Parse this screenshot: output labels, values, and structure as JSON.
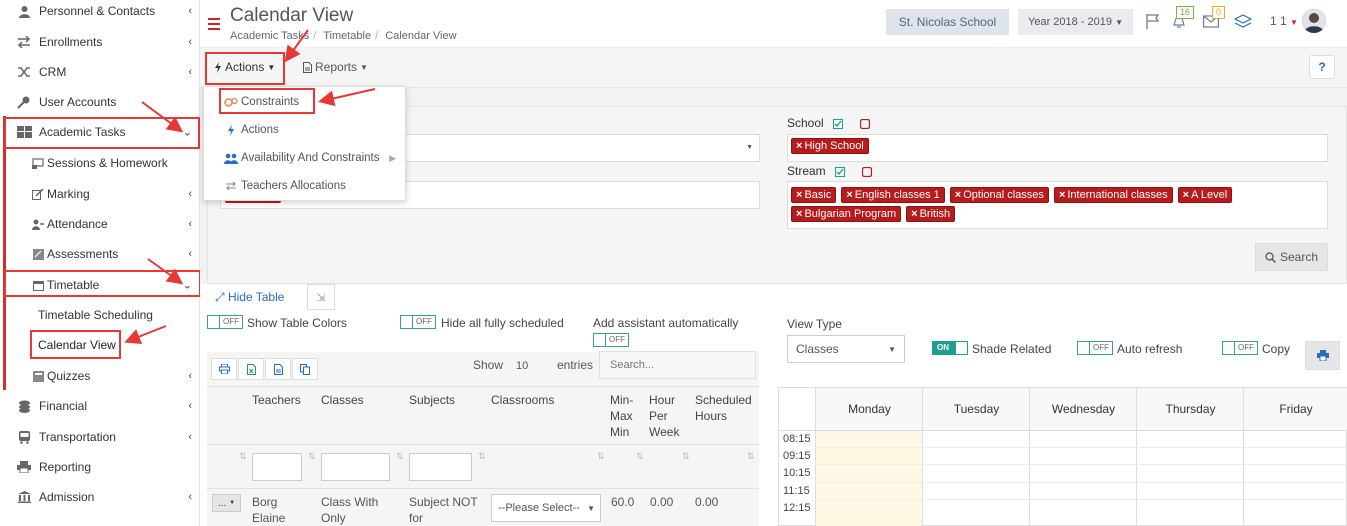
{
  "sidebar": {
    "items": [
      {
        "label": "Personnel & Contacts",
        "icon": "person-icon"
      },
      {
        "label": "Enrollments",
        "icon": "exchange-icon"
      },
      {
        "label": "CRM",
        "icon": "shuffle-icon"
      },
      {
        "label": "User Accounts",
        "icon": "key-icon"
      },
      {
        "label": "Academic Tasks",
        "icon": "grid-icon"
      },
      {
        "label": "Financial",
        "icon": "coins-icon"
      },
      {
        "label": "Transportation",
        "icon": "bus-icon"
      },
      {
        "label": "Reporting",
        "icon": "printer-icon"
      },
      {
        "label": "Admission",
        "icon": "bank-icon"
      }
    ],
    "academic_sub": [
      {
        "label": "Sessions & Homework"
      },
      {
        "label": "Marking"
      },
      {
        "label": "Attendance"
      },
      {
        "label": "Assessments"
      },
      {
        "label": "Timetable"
      },
      {
        "label": "Timetable Scheduling"
      },
      {
        "label": "Calendar View"
      },
      {
        "label": "Quizzes"
      }
    ]
  },
  "header": {
    "title": "Calendar View",
    "breadcrumb": [
      "Academic Tasks",
      "Timetable",
      "Calendar View"
    ],
    "school": "St. Nicolas School",
    "year": "Year 2018 - 2019",
    "notif_count": "16",
    "mail_count": "0",
    "user_count": "1 1"
  },
  "toolbar": {
    "actions_label": "Actions",
    "reports_label": "Reports",
    "help_label": "?"
  },
  "dropdown": {
    "items": [
      "Constraints",
      "Actions",
      "Availability And Constraints",
      "Teachers Allocations"
    ]
  },
  "filters": {
    "school_label": "School",
    "school_tags": [
      "High School"
    ],
    "stream_label": "Stream",
    "stream_tags": [
      "Basic",
      "English classes 1",
      "Optional classes",
      "International classes",
      "A Level",
      "Bulgarian Program",
      "British"
    ],
    "search_label": "Search"
  },
  "options": {
    "hide_table": "Hide Table",
    "show_table_colors": "Show Table Colors",
    "hide_all_scheduled": "Hide all fully scheduled",
    "add_assistant": "Add assistant automatically",
    "off": "OFF",
    "on": "ON",
    "view_type_label": "View Type",
    "view_type_value": "Classes",
    "shade_related": "Shade Related",
    "auto_refresh": "Auto refresh",
    "copy": "Copy"
  },
  "table": {
    "show_label": "Show",
    "page_size": "10",
    "entries_label": "entries",
    "search_placeholder": "Search...",
    "headers": [
      "Teachers",
      "Classes",
      "Subjects",
      "Classrooms",
      "Min- Max Min",
      "Hour Per Week",
      "Scheduled Hours"
    ],
    "row": {
      "action": "...",
      "teacher": "Borg Elaine",
      "classes": "Class With Only",
      "subjects": "Subject NOT for",
      "classroom": "--Please Select--",
      "minmax": "60.0",
      "hours": "0.00",
      "scheduled": "0.00"
    }
  },
  "calendar": {
    "days": [
      "Monday",
      "Tuesday",
      "Wednesday",
      "Thursday",
      "Friday"
    ],
    "times": [
      "08:15",
      "09:15",
      "10:15",
      "11:15",
      "12:15"
    ]
  },
  "colors": {
    "accent": "#c62828",
    "link": "#2a6ebb",
    "toggle_on": "#1e9e8e",
    "annotation": "#e53935"
  }
}
